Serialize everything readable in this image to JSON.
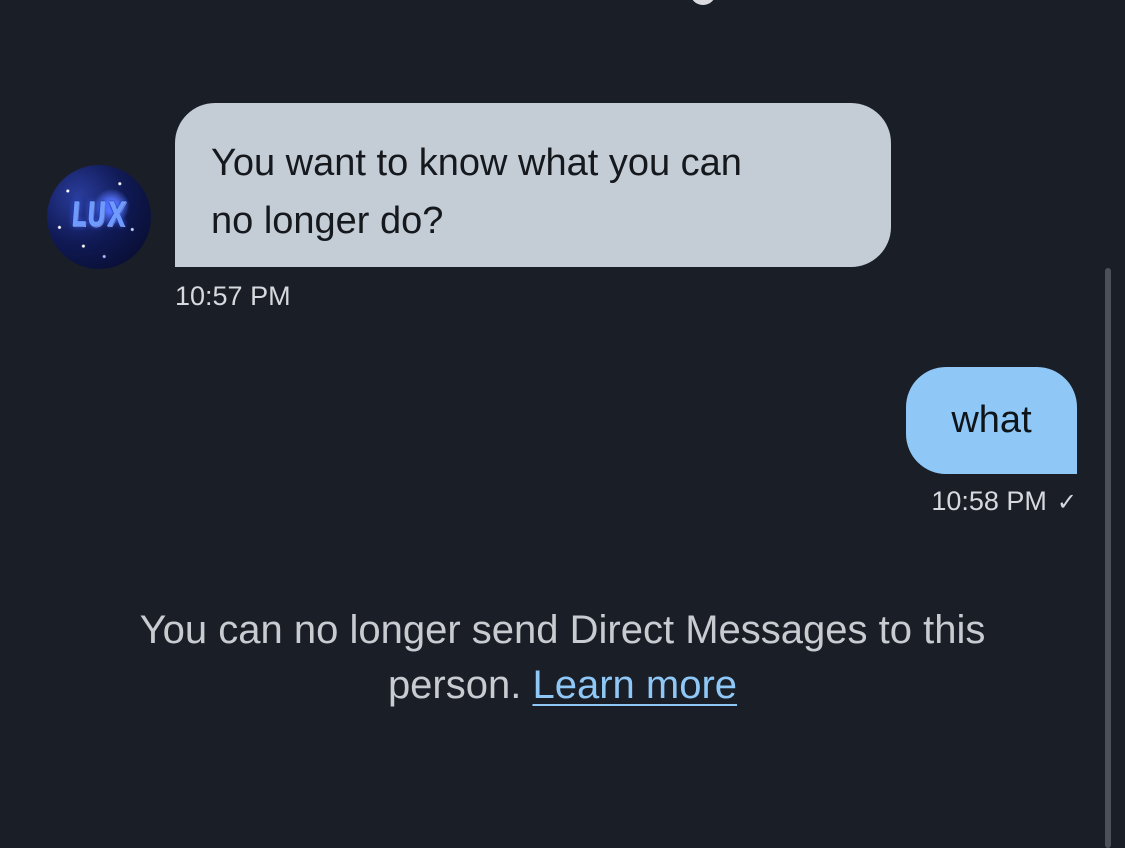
{
  "conversation": {
    "avatar_text": "LUX",
    "messages": [
      {
        "direction": "incoming",
        "lines": [
          "You want to know what you can",
          "no longer do?"
        ],
        "time": "10:57 PM"
      },
      {
        "direction": "outgoing",
        "text": "what",
        "time": "10:58 PM",
        "status_icon": "checkmark-icon",
        "status_glyph": "✓"
      }
    ],
    "notice": {
      "line1": "You can no longer send Direct Messages to this",
      "line2_prefix": "person.",
      "link_label": "Learn more"
    }
  },
  "colors": {
    "background": "#1a1e27",
    "incoming_bubble": "#c4ccd6",
    "outgoing_bubble": "#8fc8f6",
    "link": "#8fc8f6"
  }
}
